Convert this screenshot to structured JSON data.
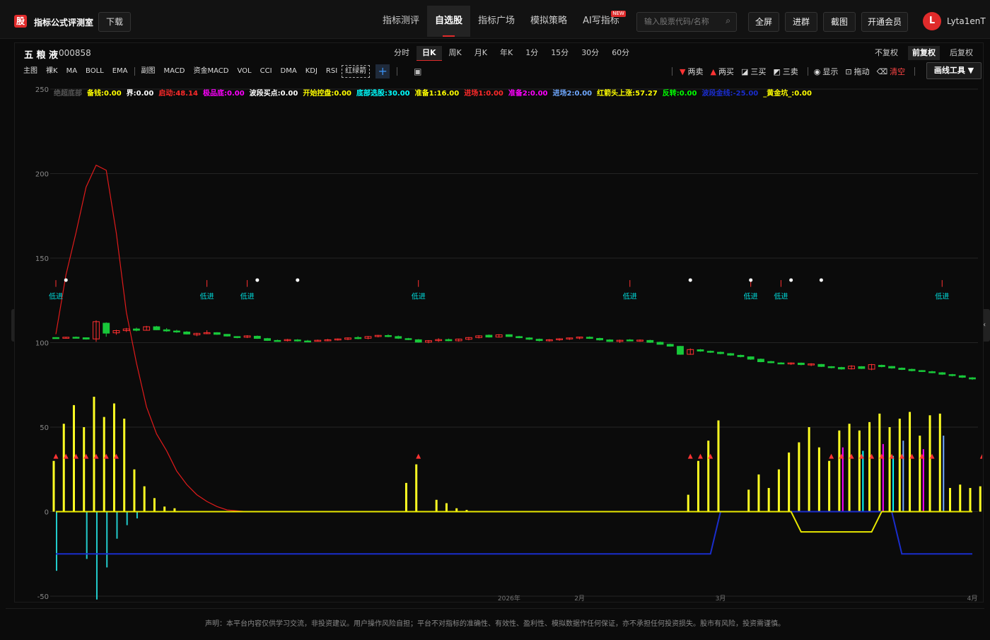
{
  "header": {
    "logo_char": "股",
    "brand": "指标公式评测室",
    "download": "下载",
    "nav": [
      {
        "label": "指标测评"
      },
      {
        "label": "自选股",
        "active": true
      },
      {
        "label": "指标广场"
      },
      {
        "label": "模拟策略"
      },
      {
        "label": "AI写指标",
        "badge": "NEW"
      }
    ],
    "search_placeholder": "输入股票代码/名称",
    "buttons": [
      "全屏",
      "进群",
      "截图",
      "开通会员"
    ],
    "user_initial": "L",
    "user_name": "Lyta1enT"
  },
  "stock": {
    "name": "五 粮 液",
    "code": "000858"
  },
  "periods": [
    {
      "label": "分时"
    },
    {
      "label": "日K",
      "active": true
    },
    {
      "label": "周K"
    },
    {
      "label": "月K"
    },
    {
      "label": "年K"
    },
    {
      "label": "1分"
    },
    {
      "label": "15分"
    },
    {
      "label": "30分"
    },
    {
      "label": "60分"
    }
  ],
  "adjust": [
    {
      "label": "不复权"
    },
    {
      "label": "前复权",
      "active": true
    },
    {
      "label": "后复权"
    }
  ],
  "indicators_main": [
    "主图",
    "裸K",
    "MA",
    "BOLL",
    "EMA"
  ],
  "indicators_sub": [
    "副图",
    "MACD",
    "资金MACD",
    "VOL",
    "CCI",
    "DMA",
    "KDJ",
    "RSI"
  ],
  "indicator_boxed": "红绿箭",
  "tools": [
    {
      "icon": "▼",
      "color": "#ff3333",
      "label": "两卖"
    },
    {
      "icon": "▲",
      "color": "#ff3333",
      "label": "两买"
    },
    {
      "icon": "◪",
      "color": "#dddddd",
      "label": "三买"
    },
    {
      "icon": "◩",
      "color": "#dddddd",
      "label": "三卖"
    },
    {
      "icon": "◉",
      "color": "#dddddd",
      "label": "显示"
    },
    {
      "icon": "⊡",
      "color": "#dddddd",
      "label": "拖动"
    },
    {
      "icon": "⌫",
      "color": "#dddddd",
      "label": "清空",
      "label_color": "#ff4444"
    }
  ],
  "draw_tool": "画线工具 ▼",
  "legend": [
    {
      "label": "绝超底部",
      "color": "#555555"
    },
    {
      "label": "备钱:0.00",
      "color": "#ffff00"
    },
    {
      "label": "界:0.00",
      "color": "#ffffff"
    },
    {
      "label": "启动:48.14",
      "color": "#ff2a2a"
    },
    {
      "label": "极品底:0.00",
      "color": "#ff00ff"
    },
    {
      "label": "波段买点:0.00",
      "color": "#ffffff"
    },
    {
      "label": "开始控盘:0.00",
      "color": "#ffff00"
    },
    {
      "label": "底部选股:30.00",
      "color": "#00ffff"
    },
    {
      "label": "准备1:16.00",
      "color": "#ffff00"
    },
    {
      "label": "进场1:0.00",
      "color": "#ff2a2a"
    },
    {
      "label": "准备2:0.00",
      "color": "#ff00ff"
    },
    {
      "label": "进场2:0.00",
      "color": "#6fa8ff"
    },
    {
      "label": "红箭头上涨:57.27",
      "color": "#ffff00"
    },
    {
      "label": "反转:0.00",
      "color": "#00ff00"
    },
    {
      "label": "波段金线:-25.00",
      "color": "#1a2dcc"
    },
    {
      "label": "_黄金坑_:0.00",
      "color": "#ffff00"
    }
  ],
  "chart_data": {
    "type": "candlestick+indicator",
    "ylim": [
      -50,
      250
    ],
    "yticks": [
      250,
      200,
      150,
      100,
      50,
      0,
      -50
    ],
    "xticks": [
      {
        "label": "2026年",
        "idx": 45
      },
      {
        "label": "2月",
        "idx": 52
      },
      {
        "label": "3月",
        "idx": 66
      },
      {
        "label": "4月",
        "idx": 91
      }
    ],
    "candles": [
      [
        103.0,
        103.2,
        102.6,
        102.8
      ],
      [
        102.8,
        103.4,
        102.4,
        103.2
      ],
      [
        103.2,
        103.6,
        102.6,
        102.9
      ],
      [
        102.9,
        103.1,
        101.8,
        102.1
      ],
      [
        102.2,
        113.2,
        100.5,
        112.4
      ],
      [
        111.5,
        112.0,
        103.5,
        105.6
      ],
      [
        105.8,
        107.6,
        104.7,
        107.1
      ],
      [
        107.1,
        108.7,
        106.3,
        108.1
      ],
      [
        108.1,
        108.9,
        106.7,
        107.3
      ],
      [
        107.3,
        109.9,
        107.1,
        109.4
      ],
      [
        109.4,
        109.9,
        107.4,
        107.6
      ],
      [
        107.6,
        108.6,
        106.4,
        106.9
      ],
      [
        106.9,
        107.6,
        105.8,
        106.3
      ],
      [
        106.3,
        106.8,
        104.8,
        105.1
      ],
      [
        104.6,
        105.8,
        103.8,
        105.5
      ],
      [
        105.6,
        107.3,
        105.0,
        105.9
      ],
      [
        105.9,
        106.2,
        104.6,
        104.9
      ],
      [
        104.9,
        105.1,
        103.6,
        103.9
      ],
      [
        103.6,
        103.8,
        102.6,
        103.0
      ],
      [
        103.2,
        104.4,
        102.7,
        104.0
      ],
      [
        103.8,
        104.2,
        102.2,
        102.5
      ],
      [
        102.4,
        102.8,
        101.0,
        101.3
      ],
      [
        101.3,
        101.8,
        100.5,
        101.0
      ],
      [
        101.3,
        102.2,
        100.7,
        101.8
      ],
      [
        101.6,
        102.1,
        100.6,
        101.0
      ],
      [
        101.0,
        101.6,
        100.3,
        100.9
      ],
      [
        101.0,
        101.8,
        100.6,
        101.4
      ],
      [
        101.4,
        102.2,
        100.8,
        101.7
      ],
      [
        101.8,
        102.5,
        101.2,
        102.2
      ],
      [
        102.0,
        103.1,
        101.5,
        102.8
      ],
      [
        103.0,
        103.8,
        102.0,
        102.4
      ],
      [
        102.6,
        103.9,
        102.0,
        103.6
      ],
      [
        103.6,
        104.6,
        103.1,
        104.3
      ],
      [
        104.2,
        104.9,
        103.2,
        103.6
      ],
      [
        103.6,
        104.2,
        102.2,
        102.6
      ],
      [
        102.4,
        102.8,
        101.5,
        101.8
      ],
      [
        101.7,
        102.1,
        100.0,
        100.3
      ],
      [
        100.3,
        101.5,
        99.6,
        101.2
      ],
      [
        101.2,
        102.6,
        100.4,
        101.8
      ],
      [
        101.8,
        102.4,
        100.8,
        101.1
      ],
      [
        101.1,
        102.4,
        100.6,
        102.1
      ],
      [
        102.0,
        103.3,
        101.4,
        103.0
      ],
      [
        103.0,
        104.4,
        102.5,
        104.0
      ],
      [
        104.4,
        104.8,
        103.0,
        103.3
      ],
      [
        103.3,
        105.0,
        103.0,
        104.6
      ],
      [
        104.7,
        104.9,
        103.4,
        103.6
      ],
      [
        103.6,
        104.0,
        102.6,
        102.9
      ],
      [
        102.8,
        103.2,
        101.6,
        102.0
      ],
      [
        102.0,
        102.4,
        100.7,
        101.2
      ],
      [
        101.2,
        102.1,
        100.6,
        101.7
      ],
      [
        101.7,
        102.6,
        101.1,
        102.3
      ],
      [
        102.2,
        103.0,
        101.6,
        102.8
      ],
      [
        102.9,
        103.5,
        102.0,
        103.3
      ],
      [
        103.2,
        103.7,
        102.2,
        102.5
      ],
      [
        102.5,
        102.9,
        101.2,
        101.6
      ],
      [
        101.6,
        102.0,
        100.4,
        100.7
      ],
      [
        100.7,
        101.8,
        99.8,
        101.4
      ],
      [
        101.6,
        102.1,
        100.8,
        101.2
      ],
      [
        101.2,
        101.9,
        100.5,
        101.5
      ],
      [
        101.3,
        101.7,
        99.8,
        100.2
      ],
      [
        100.2,
        100.6,
        98.8,
        99.0
      ],
      [
        99.0,
        99.4,
        97.6,
        97.9
      ],
      [
        97.8,
        98.1,
        92.8,
        93.1
      ],
      [
        93.1,
        96.6,
        92.8,
        95.9
      ],
      [
        95.8,
        96.2,
        94.6,
        95.0
      ],
      [
        94.9,
        95.3,
        93.9,
        94.3
      ],
      [
        94.3,
        94.7,
        93.1,
        93.5
      ],
      [
        93.5,
        93.9,
        92.2,
        92.6
      ],
      [
        92.5,
        92.9,
        91.3,
        91.7
      ],
      [
        91.6,
        91.9,
        89.8,
        90.2
      ],
      [
        90.2,
        90.6,
        88.4,
        88.7
      ],
      [
        88.8,
        89.2,
        87.8,
        88.1
      ],
      [
        88.0,
        88.4,
        87.2,
        87.6
      ],
      [
        87.5,
        88.3,
        86.8,
        88.0
      ],
      [
        87.9,
        88.2,
        86.6,
        87.0
      ],
      [
        86.8,
        87.8,
        86.1,
        87.4
      ],
      [
        87.1,
        87.4,
        85.6,
        85.9
      ],
      [
        85.8,
        86.1,
        84.8,
        85.2
      ],
      [
        85.3,
        85.7,
        84.0,
        84.4
      ],
      [
        84.5,
        86.6,
        84.1,
        86.1
      ],
      [
        85.8,
        86.1,
        84.4,
        84.7
      ],
      [
        84.3,
        87.4,
        83.7,
        87.0
      ],
      [
        86.6,
        87.0,
        85.4,
        85.8
      ],
      [
        85.9,
        86.2,
        84.6,
        85.0
      ],
      [
        84.9,
        85.3,
        83.8,
        84.1
      ],
      [
        84.2,
        84.6,
        83.0,
        83.4
      ],
      [
        83.5,
        83.8,
        82.6,
        82.9
      ],
      [
        82.8,
        83.3,
        81.9,
        82.4
      ],
      [
        82.2,
        82.6,
        80.9,
        81.3
      ],
      [
        81.1,
        81.5,
        80.0,
        80.5
      ],
      [
        80.4,
        80.8,
        79.1,
        79.5
      ],
      [
        79.2,
        79.6,
        78.0,
        78.5
      ]
    ],
    "series": [
      {
        "name": "启动",
        "color": "#e01b1b",
        "values": [
          105,
          140,
          165,
          192,
          205,
          202,
          165,
          118,
          88,
          62,
          46,
          36,
          24,
          16,
          10,
          6,
          3,
          1,
          0.5,
          0,
          0,
          0,
          0,
          0,
          0,
          0,
          0,
          0,
          0,
          0,
          0,
          0,
          0,
          0,
          0,
          0,
          0,
          0,
          0,
          0,
          0,
          0,
          0,
          0,
          0,
          0,
          0,
          0,
          0,
          0,
          0,
          0,
          0,
          0,
          0,
          0,
          0,
          0,
          0,
          0,
          0,
          0,
          0,
          0,
          0,
          0,
          0,
          0,
          0,
          0,
          0,
          0,
          0,
          0,
          0,
          0,
          0,
          0,
          0,
          0,
          0,
          0,
          0,
          0,
          0,
          0,
          0,
          0,
          0,
          0,
          0,
          0
        ]
      },
      {
        "name": "波段金线",
        "color": "#1a2dcc",
        "values": [
          -25,
          -25,
          -25,
          -25,
          -25,
          -25,
          -25,
          -25,
          -25,
          -25,
          -25,
          -25,
          -25,
          -25,
          -25,
          -25,
          -25,
          -25,
          -25,
          -25,
          -25,
          -25,
          -25,
          -25,
          -25,
          -25,
          -25,
          -25,
          -25,
          -25,
          -25,
          -25,
          -25,
          -25,
          -25,
          -25,
          -25,
          -25,
          -25,
          -25,
          -25,
          -25,
          -25,
          -25,
          -25,
          -25,
          -25,
          -25,
          -25,
          -25,
          -25,
          -25,
          -25,
          -25,
          -25,
          -25,
          -25,
          -25,
          -25,
          -25,
          -25,
          -25,
          -25,
          -25,
          -25,
          -25,
          0,
          0,
          0,
          0,
          0,
          0,
          0,
          0,
          0,
          0,
          0,
          0,
          0,
          0,
          0,
          0,
          0,
          0,
          -25,
          -25,
          -25,
          -25,
          -25,
          -25,
          -25,
          -25
        ]
      },
      {
        "name": "黄金坑",
        "color": "#e8e800",
        "values": [
          0,
          0,
          0,
          0,
          0,
          0,
          0,
          0,
          0,
          0,
          0,
          0,
          0,
          0,
          0,
          0,
          0,
          0,
          0,
          0,
          0,
          0,
          0,
          0,
          0,
          0,
          0,
          0,
          0,
          0,
          0,
          0,
          0,
          0,
          0,
          0,
          0,
          0,
          0,
          0,
          0,
          0,
          0,
          0,
          0,
          0,
          0,
          0,
          0,
          0,
          0,
          0,
          0,
          0,
          0,
          0,
          0,
          0,
          0,
          0,
          0,
          0,
          0,
          0,
          0,
          0,
          0,
          0,
          0,
          0,
          0,
          0,
          0,
          0,
          -12,
          -12,
          -12,
          -12,
          -12,
          -12,
          -12,
          -12,
          0,
          0,
          0,
          0,
          0,
          0,
          0,
          0,
          0,
          0
        ]
      }
    ],
    "bars_yellow": [
      [
        0,
        30
      ],
      [
        1,
        52
      ],
      [
        2,
        63
      ],
      [
        3,
        50
      ],
      [
        4,
        68
      ],
      [
        5,
        56
      ],
      [
        6,
        64
      ],
      [
        7,
        55
      ],
      [
        8,
        25
      ],
      [
        9,
        15
      ],
      [
        10,
        8
      ],
      [
        11,
        3
      ],
      [
        12,
        2
      ],
      [
        35,
        17
      ],
      [
        36,
        28
      ],
      [
        38,
        7
      ],
      [
        39,
        5
      ],
      [
        40,
        2
      ],
      [
        41,
        1
      ],
      [
        63,
        10
      ],
      [
        64,
        30
      ],
      [
        65,
        42
      ],
      [
        66,
        54
      ],
      [
        69,
        13
      ],
      [
        70,
        22
      ],
      [
        71,
        14
      ],
      [
        72,
        25
      ],
      [
        73,
        35
      ],
      [
        74,
        41
      ],
      [
        75,
        50
      ],
      [
        76,
        38
      ],
      [
        77,
        30
      ],
      [
        78,
        48
      ],
      [
        79,
        52
      ],
      [
        80,
        48
      ],
      [
        81,
        53
      ],
      [
        82,
        58
      ],
      [
        83,
        50
      ],
      [
        84,
        55
      ],
      [
        85,
        59
      ],
      [
        86,
        45
      ],
      [
        87,
        57
      ],
      [
        88,
        58
      ],
      [
        89,
        14
      ],
      [
        90,
        16
      ],
      [
        91,
        14
      ],
      [
        92,
        15
      ],
      [
        93,
        25
      ],
      [
        94,
        42
      ],
      [
        95,
        50
      ]
    ],
    "markers": [
      {
        "idx": 0,
        "text": "低进",
        "color": "#00dddd"
      },
      {
        "idx": 15,
        "text": "低进",
        "color": "#00dddd"
      },
      {
        "idx": 19,
        "text": "低进",
        "color": "#00dddd"
      },
      {
        "idx": 36,
        "text": "低进",
        "color": "#00dddd"
      },
      {
        "idx": 57,
        "text": "低进",
        "color": "#00dddd"
      },
      {
        "idx": 69,
        "text": "低进",
        "color": "#00dddd"
      },
      {
        "idx": 72,
        "text": "低进",
        "color": "#00dddd"
      },
      {
        "idx": 88,
        "text": "低进",
        "color": "#00dddd"
      }
    ],
    "dots": [
      1,
      20,
      24,
      63,
      69,
      73,
      76
    ]
  },
  "footer": "声明：本平台内容仅供学习交流，非投资建议。用户操作风险自担；平台不对指标的准确性、有效性、盈利性、模拟数据作任何保证，亦不承担任何投资损失。股市有风险，投资需谨慎。"
}
